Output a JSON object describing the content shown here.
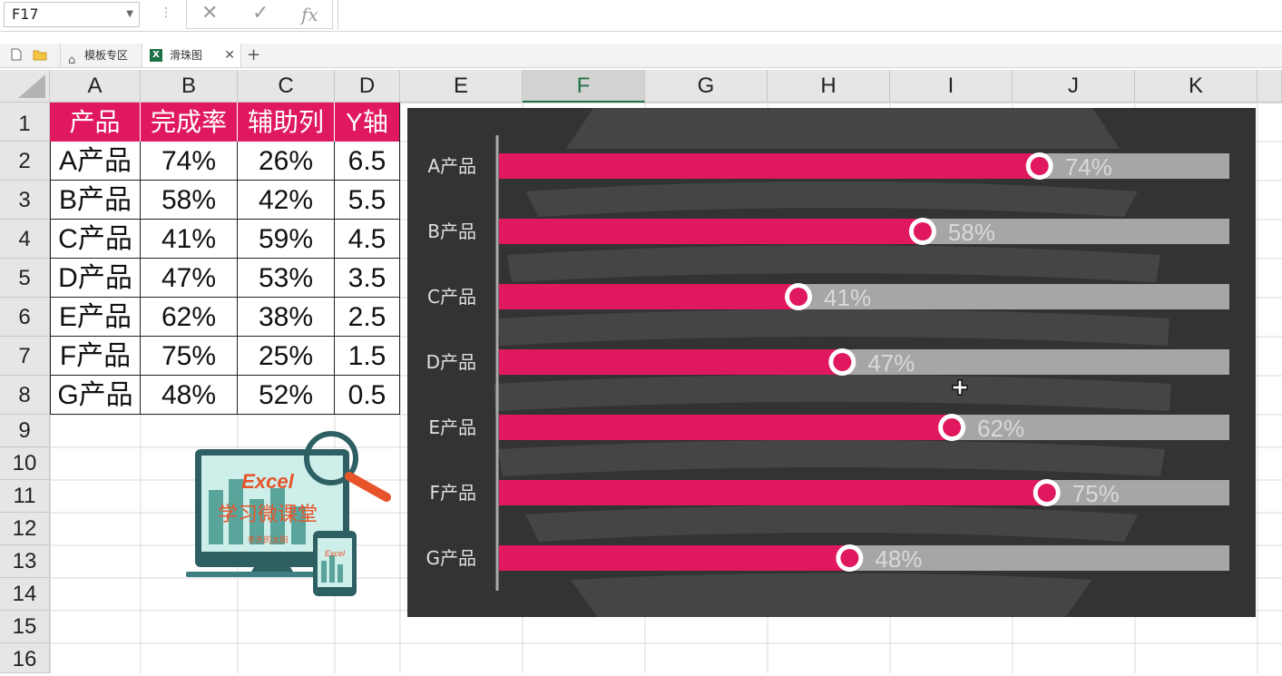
{
  "formula_bar": {
    "name_box": "F17",
    "fx_label": "fx",
    "cancel_symbol": "✕",
    "confirm_symbol": "✓"
  },
  "tabs": [
    {
      "label": "模板专区"
    },
    {
      "label": "滑珠图"
    }
  ],
  "columns": [
    "A",
    "B",
    "C",
    "D",
    "E",
    "F",
    "G",
    "H",
    "I",
    "J",
    "K"
  ],
  "selected_column": "F",
  "rows": [
    "1",
    "2",
    "3",
    "4",
    "5",
    "6",
    "7",
    "8",
    "9",
    "10",
    "11",
    "12",
    "13",
    "14",
    "15",
    "16"
  ],
  "table": {
    "headers": [
      "产品",
      "完成率",
      "辅助列",
      "Y轴"
    ],
    "rows": [
      [
        "A产品",
        "74%",
        "26%",
        "6.5"
      ],
      [
        "B产品",
        "58%",
        "42%",
        "5.5"
      ],
      [
        "C产品",
        "41%",
        "59%",
        "4.5"
      ],
      [
        "D产品",
        "47%",
        "53%",
        "3.5"
      ],
      [
        "E产品",
        "62%",
        "38%",
        "2.5"
      ],
      [
        "F产品",
        "75%",
        "25%",
        "1.5"
      ],
      [
        "G产品",
        "48%",
        "52%",
        "0.5"
      ]
    ]
  },
  "logo": {
    "title": "Excel",
    "subtitle": "学习微课堂",
    "tagline": "冬天的太阳",
    "phone_title": "Excel"
  },
  "chart_data": {
    "type": "bar",
    "categories": [
      "A产品",
      "B产品",
      "C产品",
      "D产品",
      "E产品",
      "F产品",
      "G产品"
    ],
    "series": [
      {
        "name": "完成率",
        "values": [
          0.74,
          0.58,
          0.41,
          0.47,
          0.62,
          0.75,
          0.48
        ],
        "color": "#e0185f"
      },
      {
        "name": "辅助列",
        "values": [
          0.26,
          0.42,
          0.59,
          0.53,
          0.38,
          0.25,
          0.52
        ],
        "color": "#a6a6a6"
      }
    ],
    "data_labels": [
      "74%",
      "58%",
      "41%",
      "47%",
      "62%",
      "75%",
      "48%"
    ],
    "xlim": [
      0,
      1
    ],
    "background": "#333333",
    "label_color": "#e0e0e0",
    "value_label_color": "#d9d9d9"
  }
}
